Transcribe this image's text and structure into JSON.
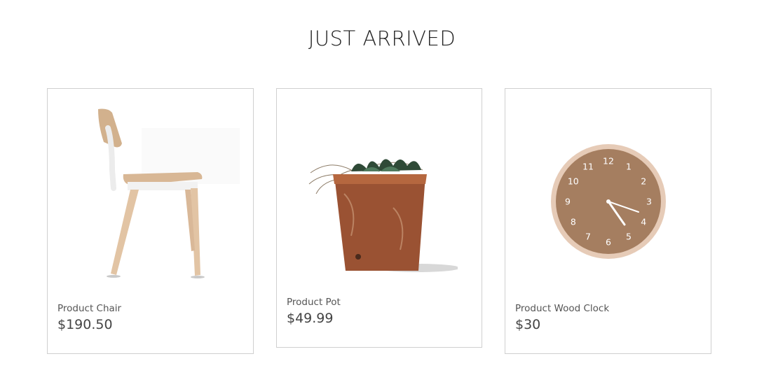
{
  "section": {
    "title": "JUST ARRIVED"
  },
  "products": [
    {
      "name": "Product Chair",
      "price": "$190.50",
      "image_icon": "chair-image"
    },
    {
      "name": "Product Pot",
      "price": "$49.99",
      "image_icon": "potted-plant-image"
    },
    {
      "name": "Product Wood Clock",
      "price": "$30",
      "image_icon": "wood-clock-image",
      "clock_numerals": [
        "12",
        "1",
        "2",
        "3",
        "4",
        "5",
        "6",
        "7",
        "8",
        "9",
        "10",
        "11"
      ]
    }
  ],
  "colors": {
    "text": "#333333",
    "border": "#cfcfcf",
    "wood": "#a57e60",
    "terracotta": "#9a5233"
  }
}
